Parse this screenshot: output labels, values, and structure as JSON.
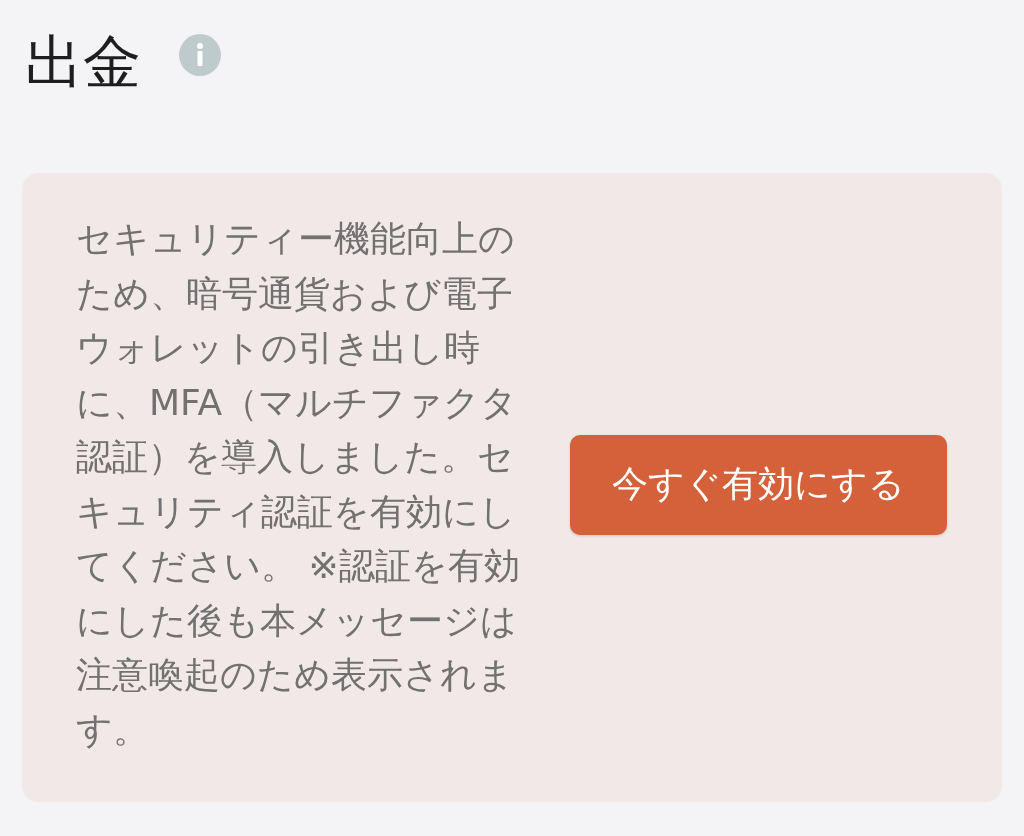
{
  "header": {
    "title": "出金"
  },
  "notice": {
    "message": "セキュリティー機能向上のため、暗号通貨および電子ウォレットの引き出し時に、MFA（マルチファクタ認証）を導入しました。セキュリティ認証を有効にしてください。 ※認証を有効にした後も本メッセージは注意喚起のため表示されます。",
    "button": {
      "label": "今すぐ有効にする"
    }
  }
}
